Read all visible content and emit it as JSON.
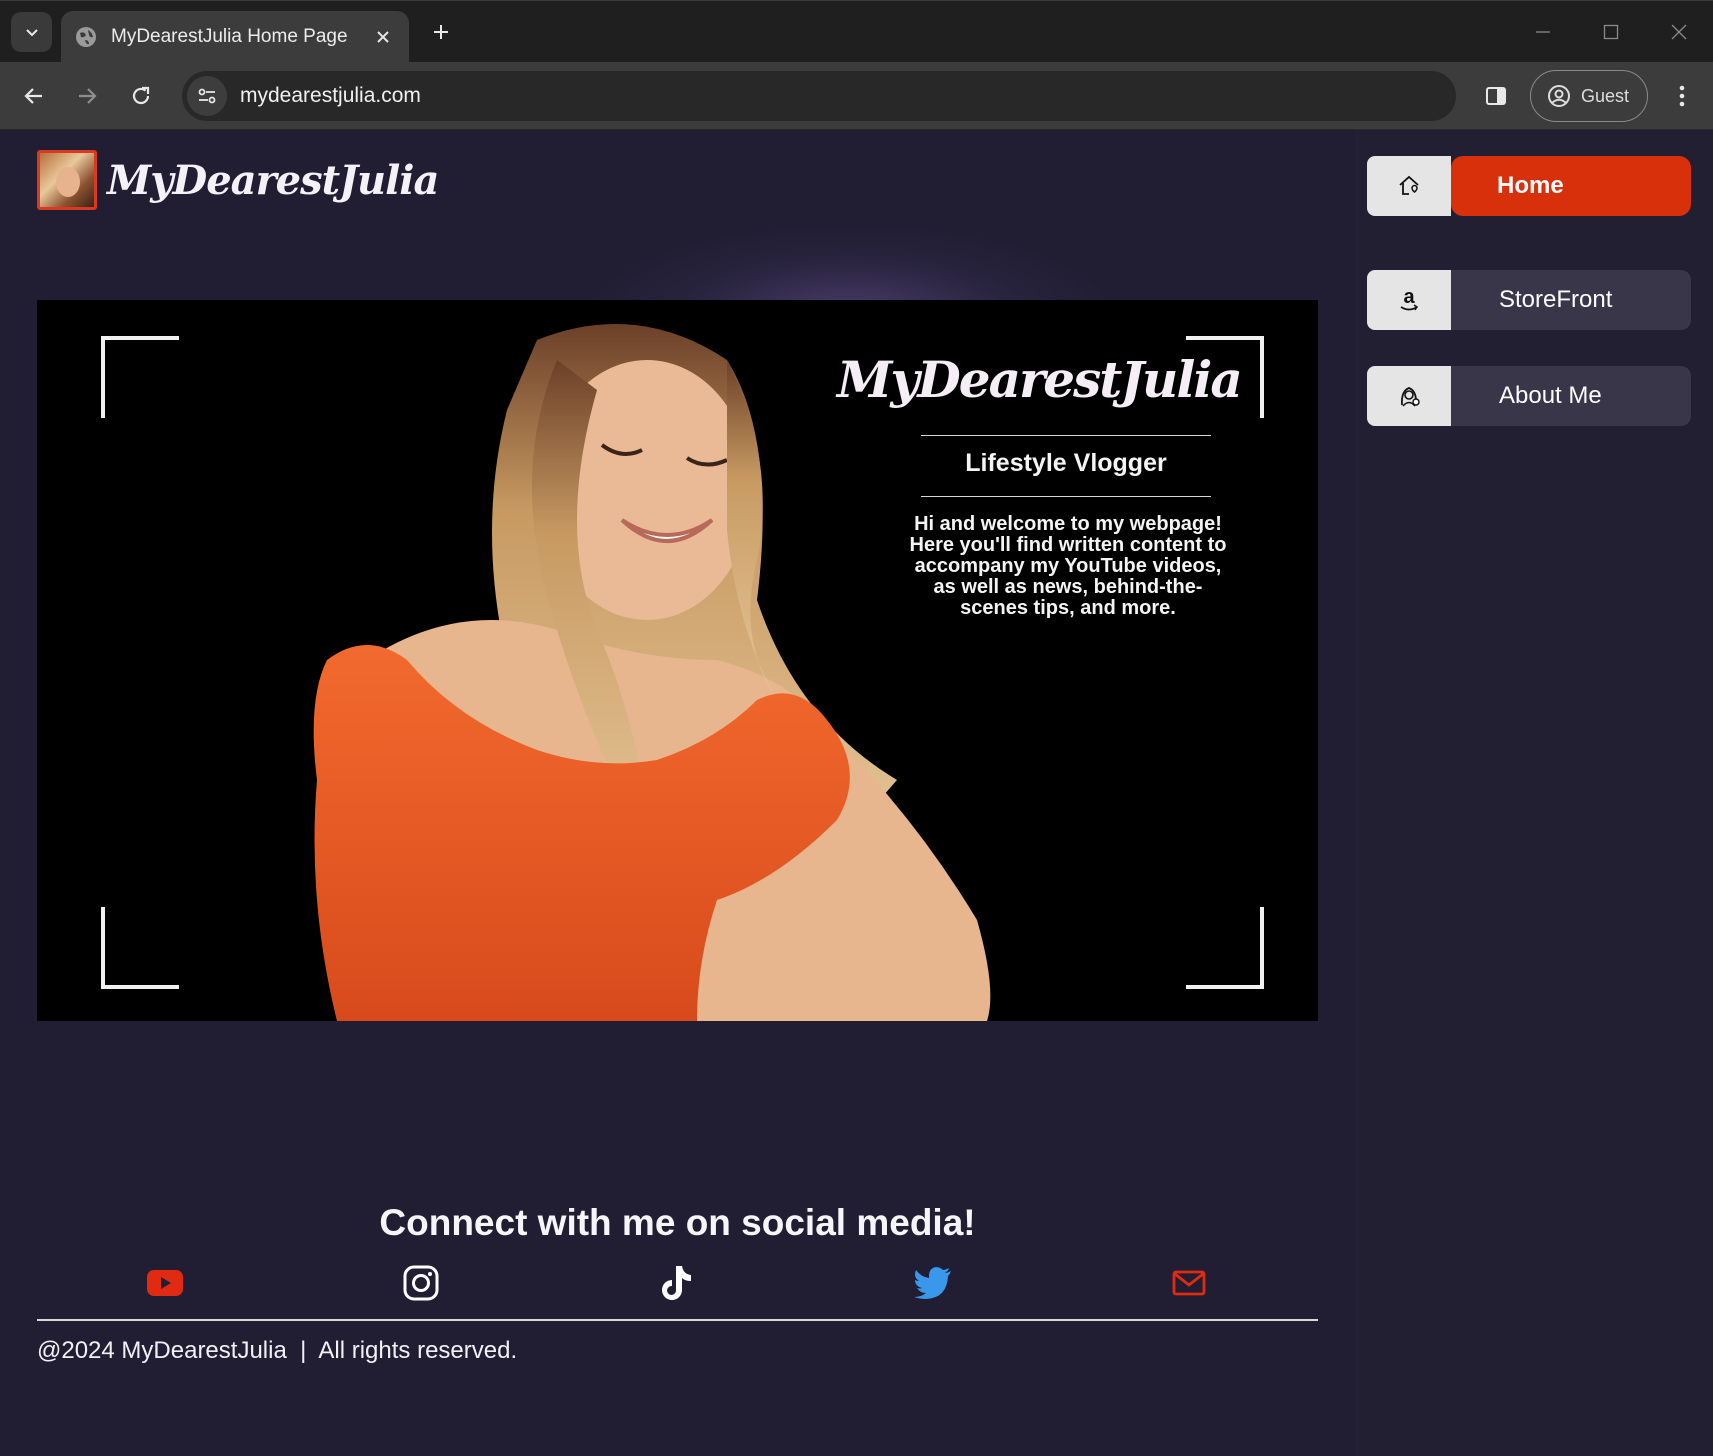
{
  "browser": {
    "tab_title": "MyDearestJulia Home Page",
    "url": "mydearestjulia.com",
    "profile_label": "Guest"
  },
  "site": {
    "logo_text": "MyDearestJulia",
    "nav": [
      {
        "label": "Home",
        "icon": "home-icon",
        "active": true
      },
      {
        "label": "StoreFront",
        "icon": "amazon-icon",
        "active": false
      },
      {
        "label": "About Me",
        "icon": "person-icon",
        "active": false
      }
    ]
  },
  "hero": {
    "title": "MyDearestJulia",
    "subtitle": "Lifestyle Vlogger",
    "description": "Hi and welcome to my webpage! Here you'll find written content to accompany my YouTube videos, as well as news, behind-the-scenes tips, and more."
  },
  "footer": {
    "connect_title": "Connect with me on social media!",
    "social": [
      {
        "name": "youtube-icon",
        "color": "#e02a12"
      },
      {
        "name": "instagram-icon",
        "color": "#ffffff"
      },
      {
        "name": "tiktok-icon",
        "color": "#ffffff"
      },
      {
        "name": "twitter-icon",
        "color": "#3a97e9"
      },
      {
        "name": "mail-icon",
        "color": "#e02a12"
      }
    ],
    "copyright": "@2024 MyDearestJulia  |  All rights reserved."
  },
  "colors": {
    "page_bg": "#211e33",
    "accent": "#d9300c",
    "nav_bg": "#3a3649"
  }
}
